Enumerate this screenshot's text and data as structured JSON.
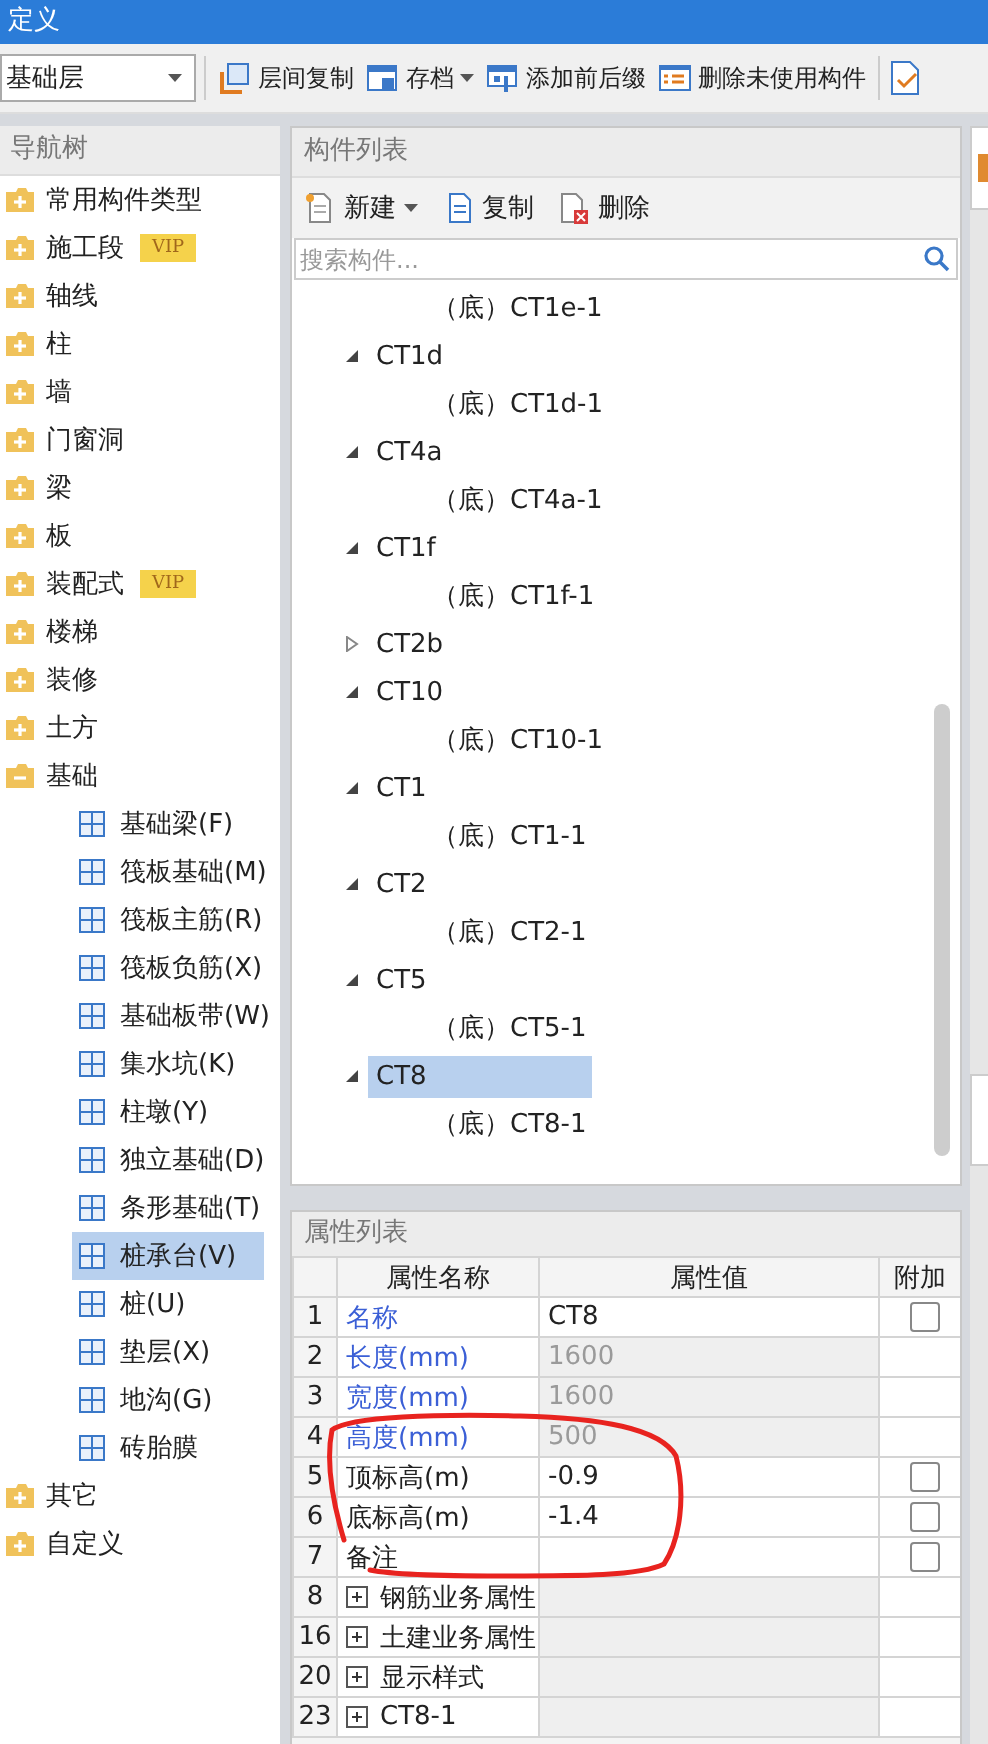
{
  "window": {
    "title": "定义"
  },
  "toolbar": {
    "floor_select": {
      "value": "基础层"
    },
    "buttons": [
      {
        "label": "层间复制",
        "dropdown": false
      },
      {
        "label": "存档",
        "dropdown": true
      },
      {
        "label": "添加前后缀",
        "dropdown": false
      },
      {
        "label": "删除未使用构件",
        "dropdown": false
      }
    ]
  },
  "navigation": {
    "title": "导航树",
    "items": [
      {
        "label": "常用构件类型",
        "expanded": false
      },
      {
        "label": "施工段",
        "expanded": false,
        "badge": "VIP"
      },
      {
        "label": "轴线",
        "expanded": false
      },
      {
        "label": "柱",
        "expanded": false
      },
      {
        "label": "墙",
        "expanded": false
      },
      {
        "label": "门窗洞",
        "expanded": false
      },
      {
        "label": "梁",
        "expanded": false
      },
      {
        "label": "板",
        "expanded": false
      },
      {
        "label": "装配式",
        "expanded": false,
        "badge": "VIP"
      },
      {
        "label": "楼梯",
        "expanded": false
      },
      {
        "label": "装修",
        "expanded": false
      },
      {
        "label": "土方",
        "expanded": false
      },
      {
        "label": "基础",
        "expanded": true,
        "children": [
          {
            "label": "基础梁(F)",
            "selected": false
          },
          {
            "label": "筏板基础(M)",
            "selected": false
          },
          {
            "label": "筏板主筋(R)",
            "selected": false
          },
          {
            "label": "筏板负筋(X)",
            "selected": false
          },
          {
            "label": "基础板带(W)",
            "selected": false
          },
          {
            "label": "集水坑(K)",
            "selected": false
          },
          {
            "label": "柱墩(Y)",
            "selected": false
          },
          {
            "label": "独立基础(D)",
            "selected": false
          },
          {
            "label": "条形基础(T)",
            "selected": false
          },
          {
            "label": "桩承台(V)",
            "selected": true
          },
          {
            "label": "桩(U)",
            "selected": false
          },
          {
            "label": "垫层(X)",
            "selected": false
          },
          {
            "label": "地沟(G)",
            "selected": false
          },
          {
            "label": "砖胎膜",
            "selected": false
          }
        ]
      },
      {
        "label": "其它",
        "expanded": false
      },
      {
        "label": "自定义",
        "expanded": false
      }
    ]
  },
  "component_list": {
    "title": "构件列表",
    "actions": [
      {
        "label": "新建",
        "dropdown": true
      },
      {
        "label": "复制",
        "dropdown": false
      },
      {
        "label": "删除",
        "dropdown": false
      }
    ],
    "search": {
      "placeholder": "搜索构件..."
    },
    "items": [
      {
        "children": [
          {
            "label": "（底）CT1e-1",
            "selected": false
          }
        ]
      },
      {
        "label": "CT1d",
        "expanded": true,
        "selected": false,
        "children": [
          {
            "label": "（底）CT1d-1",
            "selected": false
          }
        ]
      },
      {
        "label": "CT4a",
        "expanded": true,
        "selected": false,
        "children": [
          {
            "label": "（底）CT4a-1",
            "selected": false
          }
        ]
      },
      {
        "label": "CT1f",
        "expanded": true,
        "selected": false,
        "children": [
          {
            "label": "（底）CT1f-1",
            "selected": false
          }
        ]
      },
      {
        "label": "CT2b",
        "expanded": false,
        "selected": false
      },
      {
        "label": "CT10",
        "expanded": true,
        "selected": false,
        "children": [
          {
            "label": "（底）CT10-1",
            "selected": false
          }
        ]
      },
      {
        "label": "CT1",
        "expanded": true,
        "selected": false,
        "children": [
          {
            "label": "（底）CT1-1",
            "selected": false
          }
        ]
      },
      {
        "label": "CT2",
        "expanded": true,
        "selected": false,
        "children": [
          {
            "label": "（底）CT2-1",
            "selected": false
          }
        ]
      },
      {
        "label": "CT5",
        "expanded": true,
        "selected": false,
        "children": [
          {
            "label": "（底）CT5-1",
            "selected": false
          }
        ]
      },
      {
        "label": "CT8",
        "expanded": true,
        "selected": true,
        "children": [
          {
            "label": "（底）CT8-1",
            "selected": false
          }
        ]
      }
    ]
  },
  "properties": {
    "title": "属性列表",
    "columns": [
      "属性名称",
      "属性值",
      "附加"
    ],
    "rows": [
      {
        "number": "1",
        "kind": "public",
        "name": "名称",
        "value": "CT8",
        "readonly": false,
        "attach_checked": false
      },
      {
        "number": "2",
        "kind": "public",
        "name": "长度(mm)",
        "value": "1600",
        "readonly": true
      },
      {
        "number": "3",
        "kind": "public",
        "name": "宽度(mm)",
        "value": "1600",
        "readonly": true
      },
      {
        "number": "4",
        "kind": "public",
        "name": "高度(mm)",
        "value": "500",
        "readonly": true
      },
      {
        "number": "5",
        "kind": "private",
        "name": "顶标高(m)",
        "value": "-0.9",
        "readonly": false,
        "attach_checked": false
      },
      {
        "number": "6",
        "kind": "private",
        "name": "底标高(m)",
        "value": "-1.4",
        "readonly": false,
        "attach_checked": false
      },
      {
        "number": "7",
        "kind": "private",
        "name": "备注",
        "readonly": false,
        "attach_checked": false
      },
      {
        "number": "8",
        "kind": "group",
        "name": "钢筋业务属性",
        "expanded": false
      },
      {
        "number": "16",
        "kind": "group",
        "name": "土建业务属性",
        "expanded": false
      },
      {
        "number": "20",
        "kind": "group",
        "name": "显示样式",
        "expanded": false
      },
      {
        "number": "23",
        "kind": "group",
        "name": "CT8-1",
        "expanded": false
      }
    ]
  }
}
